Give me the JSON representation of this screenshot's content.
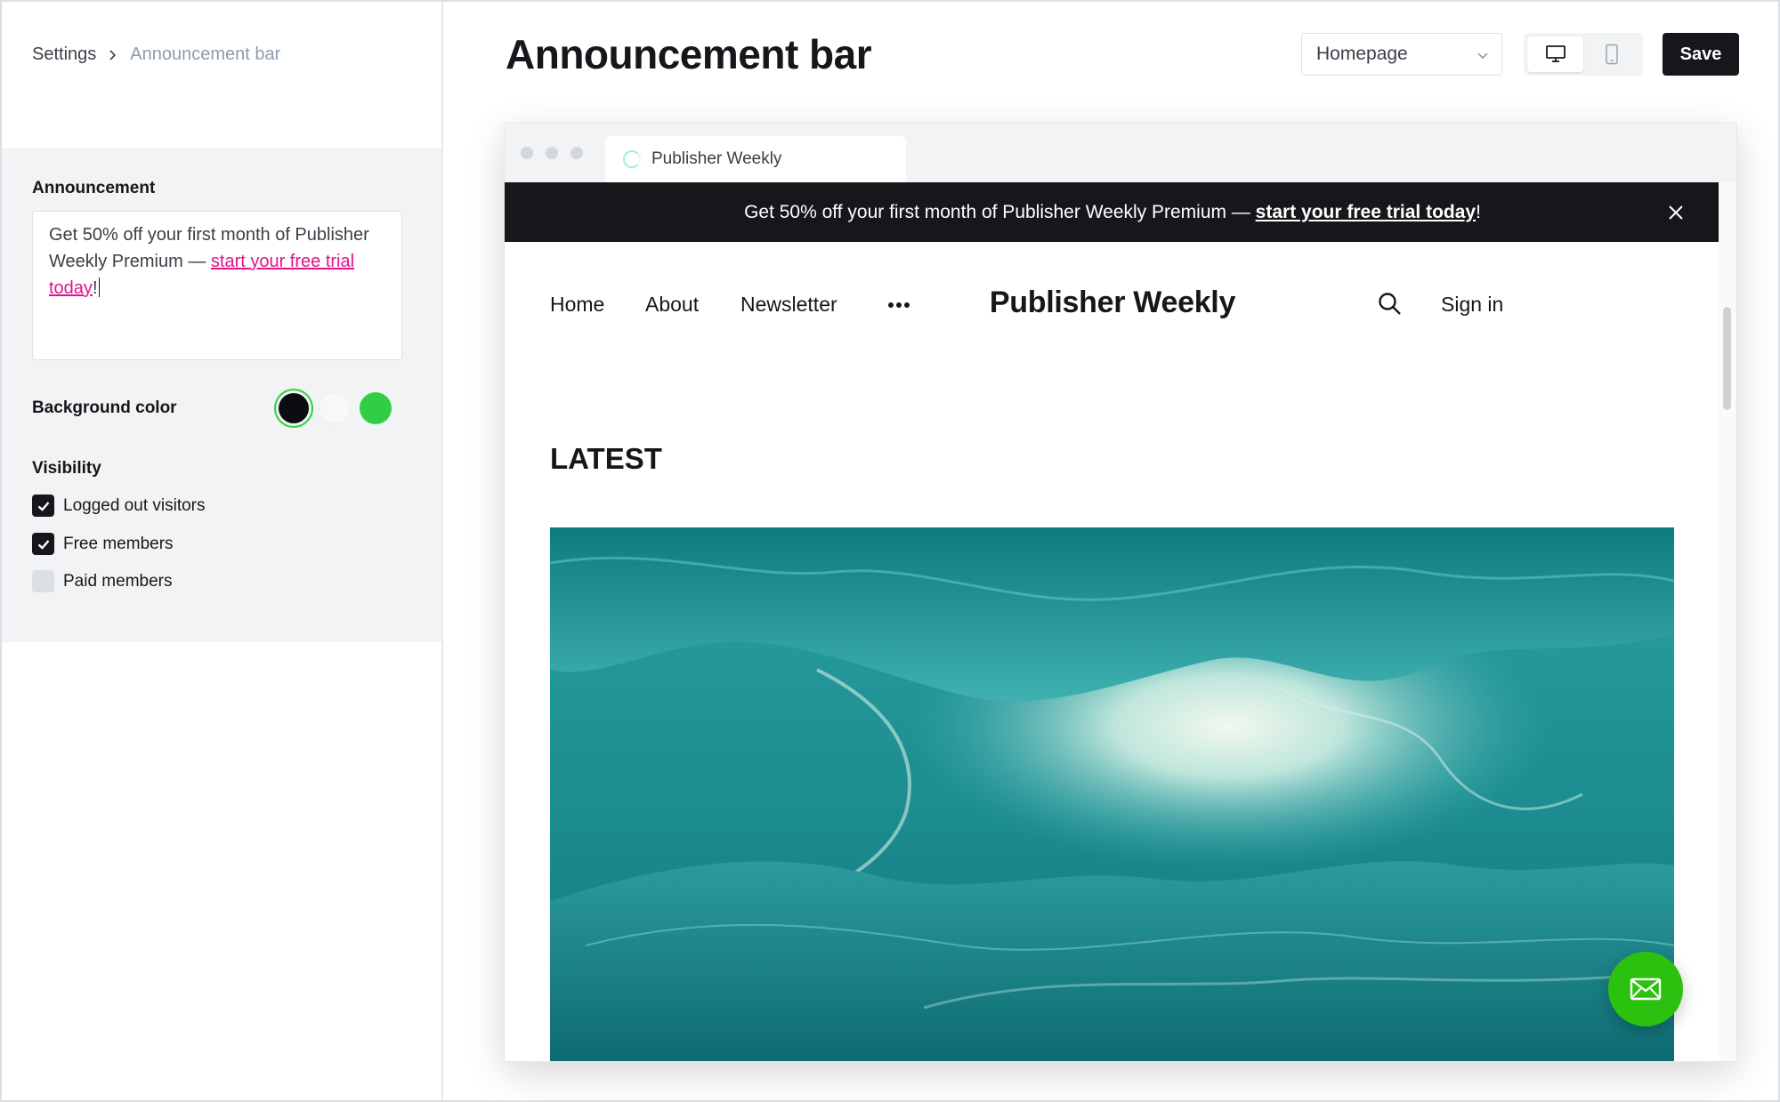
{
  "breadcrumb": {
    "root": "Settings",
    "current": "Announcement bar"
  },
  "sidebar": {
    "announcement": {
      "label": "Announcement",
      "text_before": "Get 50% off your first month of Publisher Weekly Premium — ",
      "link_text": "start your free trial today",
      "text_after": "!"
    },
    "background": {
      "label": "Background color",
      "swatches": [
        {
          "name": "black",
          "color": "#0c0d10",
          "selected": true
        },
        {
          "name": "white",
          "color": "#f7f8f8",
          "selected": false
        },
        {
          "name": "green",
          "color": "#30cf43",
          "selected": false
        }
      ]
    },
    "visibility": {
      "label": "Visibility",
      "options": [
        {
          "label": "Logged out visitors",
          "checked": true
        },
        {
          "label": "Free members",
          "checked": true
        },
        {
          "label": "Paid members",
          "checked": false
        }
      ]
    }
  },
  "header": {
    "title": "Announcement bar",
    "page_select": "Homepage",
    "device_active": "desktop",
    "save_label": "Save"
  },
  "preview": {
    "tab_title": "Publisher Weekly",
    "announcement": {
      "text_before": "Get 50% off your first month of Publisher Weekly Premium — ",
      "link_text": "start your free trial today",
      "text_after": "!"
    },
    "nav": {
      "home": "Home",
      "about": "About",
      "newsletter": "Newsletter",
      "sign_in": "Sign in"
    },
    "site_title": "Publisher Weekly",
    "latest_heading": "LATEST"
  },
  "colors": {
    "accent_link": "#e0138c",
    "fab": "#2bc10f",
    "dark": "#15171a"
  }
}
